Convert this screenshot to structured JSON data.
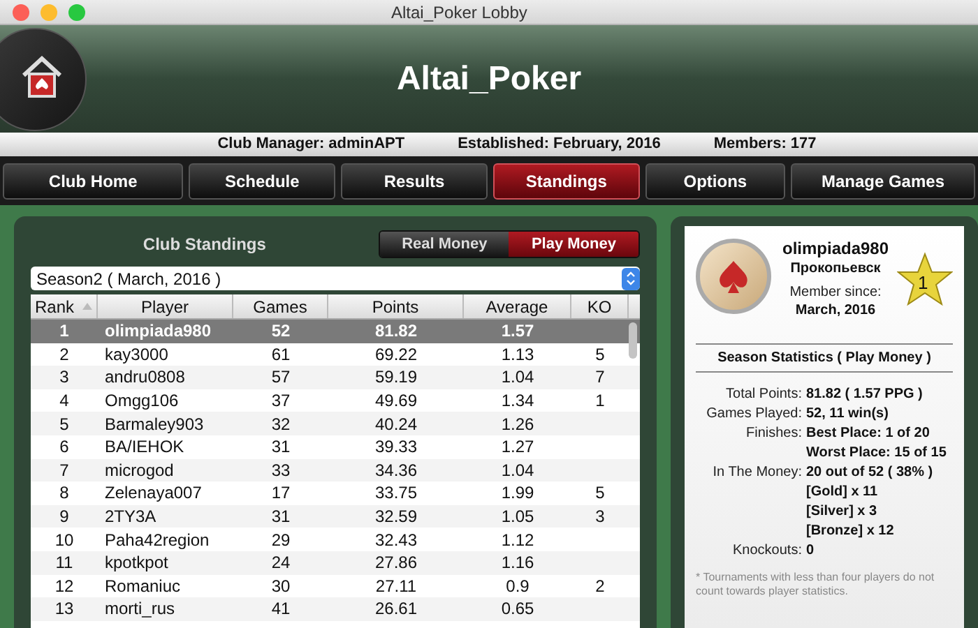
{
  "window": {
    "title": "Altai_Poker Lobby"
  },
  "header": {
    "club_name": "Altai_Poker",
    "info": [
      "Club Manager: adminAPT",
      "Established: February, 2016",
      "Members: 177"
    ]
  },
  "nav": [
    {
      "label": "Club Home",
      "selected": false
    },
    {
      "label": "Schedule",
      "selected": false
    },
    {
      "label": "Results",
      "selected": false
    },
    {
      "label": "Standings",
      "selected": true
    },
    {
      "label": "Options",
      "selected": false
    },
    {
      "label": "Manage Games",
      "selected": false
    }
  ],
  "standings": {
    "title": "Club Standings",
    "money_toggle": [
      {
        "label": "Real Money",
        "selected": false
      },
      {
        "label": "Play Money",
        "selected": true
      }
    ],
    "season": "Season2 ( March, 2016 )",
    "columns": [
      {
        "label": "Rank",
        "sorted": true
      },
      {
        "label": "Player",
        "sorted": false
      },
      {
        "label": "Games",
        "sorted": false
      },
      {
        "label": "Points",
        "sorted": false
      },
      {
        "label": "Average",
        "sorted": false
      },
      {
        "label": "KO",
        "sorted": false
      }
    ],
    "rows": [
      {
        "rank": "1",
        "player": "olimpiada980",
        "games": "52",
        "points": "81.82",
        "average": "1.57",
        "selected": true
      },
      {
        "rank": "2",
        "player": "kay3000",
        "games": "61",
        "points": "69.22",
        "average": "1.13",
        "ko": "5",
        "selected": false
      },
      {
        "rank": "3",
        "player": "andru0808",
        "games": "57",
        "points": "59.19",
        "average": "1.04",
        "ko": "7",
        "selected": false
      },
      {
        "rank": "4",
        "player": "Omgg106",
        "games": "37",
        "points": "49.69",
        "average": "1.34",
        "ko": "1",
        "selected": false
      },
      {
        "rank": "5",
        "player": "Barmaley903",
        "games": "32",
        "points": "40.24",
        "average": "1.26",
        "selected": false
      },
      {
        "rank": "6",
        "player": "BA/IEHOK",
        "games": "31",
        "points": "39.33",
        "average": "1.27",
        "selected": false
      },
      {
        "rank": "7",
        "player": "microgod",
        "games": "33",
        "points": "34.36",
        "average": "1.04",
        "selected": false
      },
      {
        "rank": "8",
        "player": "Zelenaya007",
        "games": "17",
        "points": "33.75",
        "average": "1.99",
        "ko": "5",
        "selected": false
      },
      {
        "rank": "9",
        "player": "2TY3A",
        "games": "31",
        "points": "32.59",
        "average": "1.05",
        "ko": "3",
        "selected": false
      },
      {
        "rank": "10",
        "player": "Paha42region",
        "games": "29",
        "points": "32.43",
        "average": "1.12",
        "selected": false
      },
      {
        "rank": "11",
        "player": "kpotkpot",
        "games": "24",
        "points": "27.86",
        "average": "1.16",
        "selected": false
      },
      {
        "rank": "12",
        "player": "Romaniuc",
        "games": "30",
        "points": "27.11",
        "average": "0.9",
        "ko": "2",
        "selected": false
      },
      {
        "rank": "13",
        "player": "morti_rus",
        "games": "41",
        "points": "26.61",
        "average": "0.65",
        "selected": false
      }
    ]
  },
  "profile": {
    "name": "olimpiada980",
    "city": "Прокопьевск",
    "member_since_label": "Member since:",
    "member_since": "March, 2016",
    "rank_badge": "1",
    "stats_title": "Season Statistics ( Play Money )",
    "stats": [
      {
        "label": "Total Points:",
        "value": "81.82  ( 1.57 PPG )"
      },
      {
        "label": "Games Played:",
        "value": "52, 11 win(s)"
      },
      {
        "label": "Finishes:",
        "value": "Best Place: 1 of 20"
      },
      {
        "value": "Worst Place: 15 of 15"
      },
      {
        "label": "In The Money:",
        "value": "20 out of 52  ( 38% )"
      },
      {
        "value": "[Gold] x 11"
      },
      {
        "value": "[Silver] x 3"
      },
      {
        "value": "[Bronze] x 12"
      },
      {
        "label": "Knockouts:",
        "value": "0"
      }
    ],
    "note": "* Tournaments with less than four players do not count towards player statistics."
  }
}
